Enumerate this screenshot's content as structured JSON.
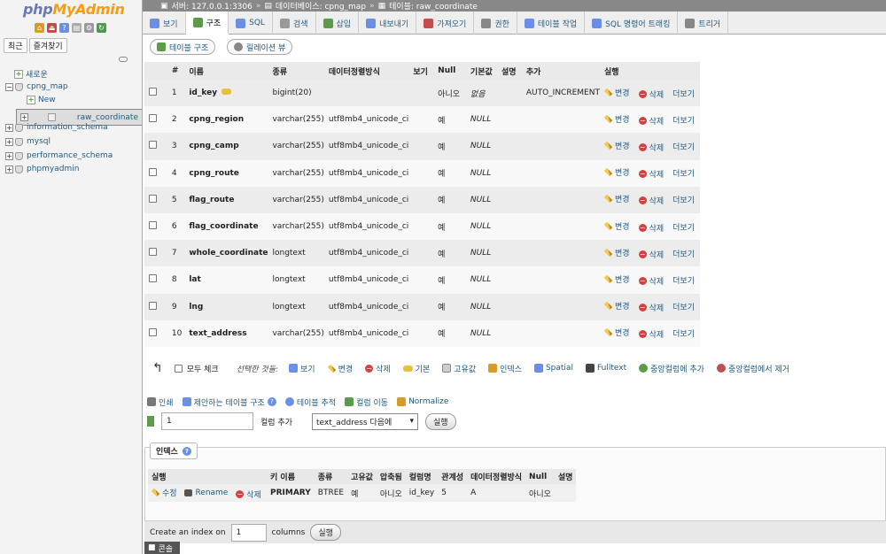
{
  "nav": {
    "logo_a": "php",
    "logo_b": "MyAdmin",
    "tab_recent": "최근",
    "tab_favorites": "즐겨찾기",
    "tree": {
      "new_top": "새로운",
      "db1": "cpng_map",
      "db1_new": "New",
      "db1_table": "raw_coordinate",
      "db2": "information_schema",
      "db3": "mysql",
      "db4": "performance_schema",
      "db5": "phpmyadmin"
    }
  },
  "breadcrumb": {
    "server": "서버: 127.0.0.1:3306",
    "database": "데이터베이스: cpng_map",
    "table": "테이블: raw_coordinate"
  },
  "tabs": [
    {
      "label": "보기",
      "icon": "browse-icon",
      "color": "#6b8ee6"
    },
    {
      "label": "구조",
      "icon": "structure-icon",
      "color": "#5b9b4a"
    },
    {
      "label": "SQL",
      "icon": "sql-icon",
      "color": "#6b8ee6"
    },
    {
      "label": "검색",
      "icon": "search-icon",
      "color": "#999999"
    },
    {
      "label": "삽입",
      "icon": "insert-icon",
      "color": "#5b9b4a"
    },
    {
      "label": "내보내기",
      "icon": "export-icon",
      "color": "#6b8ee6"
    },
    {
      "label": "가져오기",
      "icon": "import-icon",
      "color": "#c05050"
    },
    {
      "label": "권한",
      "icon": "privileges-icon",
      "color": "#888888"
    },
    {
      "label": "테이블 작업",
      "icon": "wrench-icon",
      "color": "#6b8ee6"
    },
    {
      "label": "SQL 명령어 트래킹",
      "icon": "eye-icon",
      "color": "#6b8ee6"
    },
    {
      "label": "트리거",
      "icon": "trigger-icon",
      "color": "#888888"
    }
  ],
  "subbuttons": {
    "table_structure": "테이블 구조",
    "relation_view": "릴레이션 뷰"
  },
  "structure": {
    "headers": [
      "#",
      "이름",
      "종류",
      "데이터정렬방식",
      "보기",
      "Null",
      "기본값",
      "설명",
      "추가",
      "실행"
    ],
    "edit_label": "변경",
    "drop_label": "삭제",
    "more_label": "더보기",
    "rows": [
      {
        "num": "1",
        "name": "id_key",
        "type": "bigint(20)",
        "collation": "",
        "null": "아니오",
        "default": "없음",
        "extra": "AUTO_INCREMENT"
      },
      {
        "num": "2",
        "name": "cpng_region",
        "type": "varchar(255)",
        "collation": "utf8mb4_unicode_ci",
        "null": "예",
        "default": "NULL",
        "extra": ""
      },
      {
        "num": "3",
        "name": "cpng_camp",
        "type": "varchar(255)",
        "collation": "utf8mb4_unicode_ci",
        "null": "예",
        "default": "NULL",
        "extra": ""
      },
      {
        "num": "4",
        "name": "cpng_route",
        "type": "varchar(255)",
        "collation": "utf8mb4_unicode_ci",
        "null": "예",
        "default": "NULL",
        "extra": ""
      },
      {
        "num": "5",
        "name": "flag_route",
        "type": "varchar(255)",
        "collation": "utf8mb4_unicode_ci",
        "null": "예",
        "default": "NULL",
        "extra": ""
      },
      {
        "num": "6",
        "name": "flag_coordinate",
        "type": "varchar(255)",
        "collation": "utf8mb4_unicode_ci",
        "null": "예",
        "default": "NULL",
        "extra": ""
      },
      {
        "num": "7",
        "name": "whole_coordinate",
        "type": "longtext",
        "collation": "utf8mb4_unicode_ci",
        "null": "예",
        "default": "NULL",
        "extra": ""
      },
      {
        "num": "8",
        "name": "lat",
        "type": "longtext",
        "collation": "utf8mb4_unicode_ci",
        "null": "예",
        "default": "NULL",
        "extra": ""
      },
      {
        "num": "9",
        "name": "lng",
        "type": "longtext",
        "collation": "utf8mb4_unicode_ci",
        "null": "예",
        "default": "NULL",
        "extra": ""
      },
      {
        "num": "10",
        "name": "text_address",
        "type": "varchar(255)",
        "collation": "utf8mb4_unicode_ci",
        "null": "예",
        "default": "NULL",
        "extra": ""
      }
    ]
  },
  "bulk": {
    "check_all": "모두 체크",
    "with_selected": "선택한 것들:",
    "browse": "보기",
    "change": "변경",
    "drop": "삭제",
    "primary": "기본",
    "unique": "고유값",
    "index": "인덱스",
    "spatial": "Spatial",
    "fulltext": "Fulltext",
    "add_central": "중앙컬럼에 추가",
    "remove_central": "중앙컬럼에서 제거"
  },
  "tools": {
    "print": "인쇄",
    "propose": "제안하는 테이블 구조",
    "track": "테이블 추적",
    "move_columns": "컬럼 이동",
    "normalize": "Normalize"
  },
  "add_column": {
    "count": "1",
    "label": "컬럼 추가",
    "position": "text_address 다음에",
    "go": "실행"
  },
  "indexes": {
    "title": "인덱스",
    "headers": [
      "실행",
      "키 이름",
      "종류",
      "고유값",
      "압축됨",
      "컬럼명",
      "관계성",
      "데이터정렬방식",
      "Null",
      "설명"
    ],
    "edit": "수정",
    "rename": "Rename",
    "drop": "삭제",
    "row": {
      "key_name": "PRIMARY",
      "type": "BTREE",
      "unique": "예",
      "packed": "아니오",
      "column": "id_key",
      "cardinality": "5",
      "collation": "A",
      "null": "아니오",
      "comment": ""
    },
    "create_prefix": "Create an index on",
    "create_count": "1",
    "create_suffix": "columns",
    "go": "실행"
  },
  "console": "콘솔"
}
